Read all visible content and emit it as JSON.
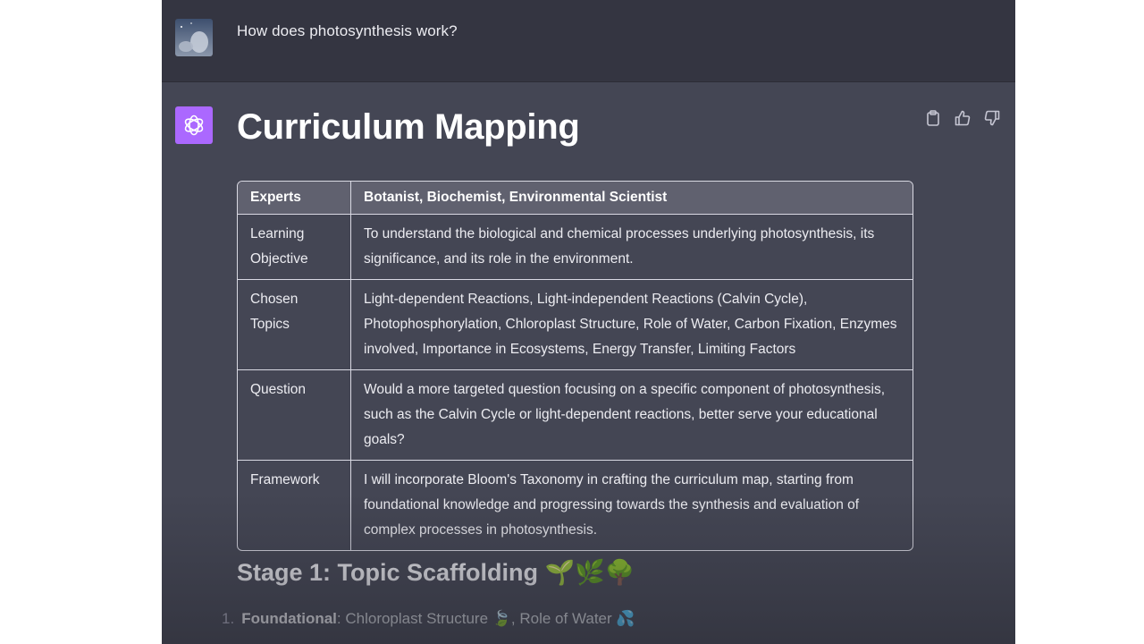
{
  "user_message": {
    "text": "How does photosynthesis work?"
  },
  "assistant_message": {
    "title": "Curriculum Mapping",
    "actions": {
      "copy_icon": "clipboard-icon",
      "like_icon": "thumbs-up-icon",
      "dislike_icon": "thumbs-down-icon"
    },
    "table": {
      "headers": [
        "Experts",
        "Botanist, Biochemist, Environmental Scientist"
      ],
      "rows": [
        {
          "label": "Learning Objective",
          "value": "To understand the biological and chemical processes underlying photosynthesis, its significance, and its role in the environment."
        },
        {
          "label": "Chosen Topics",
          "value": "Light-dependent Reactions, Light-independent Reactions (Calvin Cycle), Photophosphorylation, Chloroplast Structure, Role of Water, Carbon Fixation, Enzymes involved, Importance in Ecosystems, Energy Transfer, Limiting Factors"
        },
        {
          "label": "Question",
          "value": "Would a more targeted question focusing on a specific component of photosynthesis, such as the Calvin Cycle or light-dependent reactions, better serve your educational goals?"
        },
        {
          "label": "Framework",
          "value": "I will incorporate Bloom's Taxonomy in crafting the curriculum map, starting from foundational knowledge and progressing towards the synthesis and evaluation of complex processes in photosynthesis."
        }
      ]
    },
    "stage": {
      "heading": "Stage 1: Topic Scaffolding 🌱🌿🌳",
      "items": [
        {
          "number": "1.",
          "label": "Foundational",
          "text": ": Chloroplast Structure 🍃, Role of Water 💦"
        }
      ]
    }
  },
  "colors": {
    "user_bg": "#343541",
    "assistant_bg": "#444654",
    "bot_avatar": "#ab68ff",
    "table_header_bg": "#60616f"
  }
}
